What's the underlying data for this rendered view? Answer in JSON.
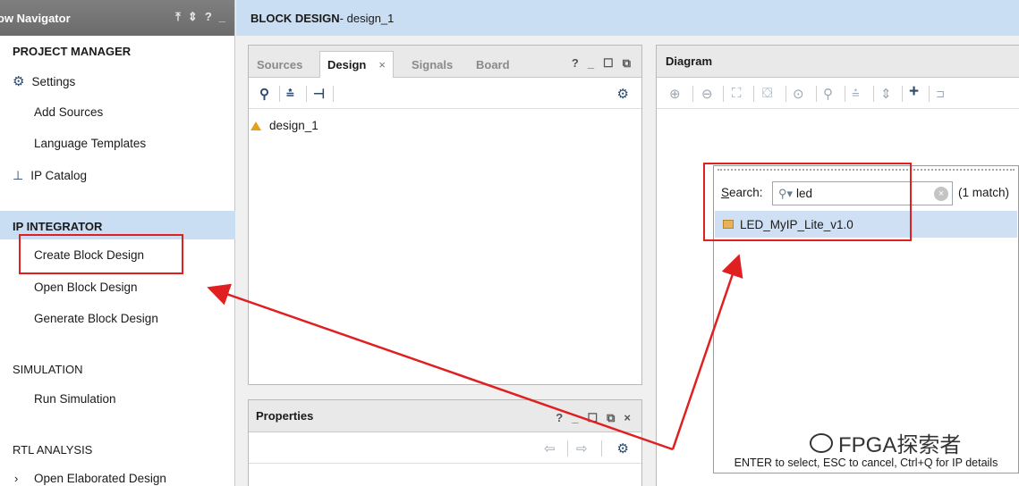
{
  "nav": {
    "header_title": "ow Navigator",
    "header_ctrls": [
      "⤒",
      "⇕",
      "?",
      "_"
    ],
    "project_manager": "PROJECT MANAGER",
    "settings": "Settings",
    "add_sources": "Add Sources",
    "language_templates": "Language Templates",
    "ip_catalog": "IP Catalog",
    "ip_integrator": "IP INTEGRATOR",
    "create_block_design": "Create Block Design",
    "open_block_design": "Open Block Design",
    "generate_block_design": "Generate Block Design",
    "simulation": "SIMULATION",
    "run_simulation": "Run Simulation",
    "rtl_analysis": "RTL ANALYSIS",
    "open_elaborated_design": "Open Elaborated Design"
  },
  "topbar": {
    "title": "BLOCK DESIGN",
    "subtitle": " - design_1"
  },
  "design_panel": {
    "tabs": [
      "Sources",
      "Design",
      "Signals",
      "Board"
    ],
    "tab_close": "×",
    "ctrls": [
      "?",
      "_",
      "☐",
      "⧉"
    ],
    "tree_item": "design_1"
  },
  "properties": {
    "title": "Properties",
    "ctrls": [
      "?",
      "_",
      "☐",
      "⧉",
      "×"
    ]
  },
  "diagram": {
    "title": "Diagram"
  },
  "search": {
    "label_prefix": "S",
    "label_rest": "earch:",
    "value": "led",
    "match_count": "(1 match)",
    "result": "LED_MyIP_Lite_v1.0",
    "footer": "ENTER to select, ESC to cancel, Ctrl+Q for IP details"
  },
  "watermark": "FPGA探索者",
  "colors": {
    "highlight": "#c9ddf3",
    "annotation_red": "#e02020",
    "nav_header": "#737373"
  }
}
